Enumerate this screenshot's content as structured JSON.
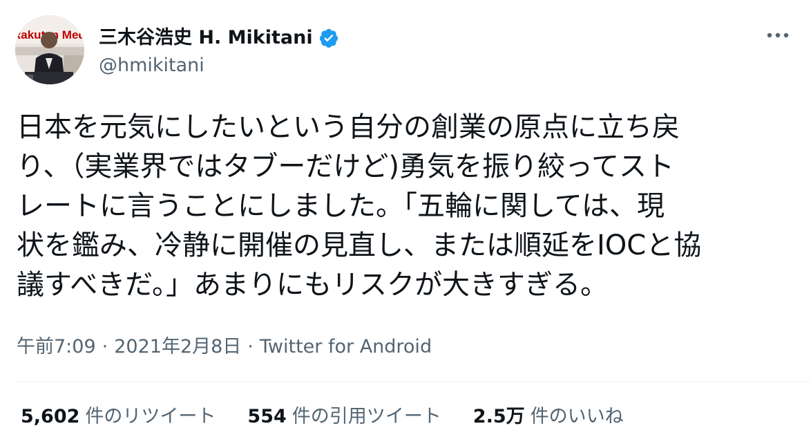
{
  "author": {
    "display_name": "三木谷浩史 H. Mikitani",
    "handle": "@hmikitani",
    "verified_icon": "verified-badge-icon",
    "avatar_backdrop_text": "Rakuten Media"
  },
  "menu": {
    "more_icon": "more-horizontal-icon"
  },
  "tweet": {
    "lines": [
      "日本を元気にしたいという自分の創業の原点に立ち戻",
      "り、（実業界ではタブーだけど)勇気を振り絞ってスト",
      "レートに言うことにしました。「五輪に関しては、現",
      "状を鑑み、冷静に開催の見直し、または順延をIOCと協",
      "議すべきだ。」あまりにもリスクが大きすぎる。"
    ]
  },
  "meta": {
    "time": "午前7:09",
    "separator": "·",
    "date": "2021年2月8日",
    "source": "Twitter for Android"
  },
  "stats": {
    "retweets": {
      "count": "5,602",
      "label": "件のリツイート"
    },
    "quotes": {
      "count": "554",
      "label": "件の引用ツイート"
    },
    "likes": {
      "count": "2.5万",
      "label": "件のいいね"
    }
  },
  "colors": {
    "text": "#0f1419",
    "secondary": "#536471",
    "verified": "#1d9bf0",
    "divider": "#eff3f4"
  }
}
